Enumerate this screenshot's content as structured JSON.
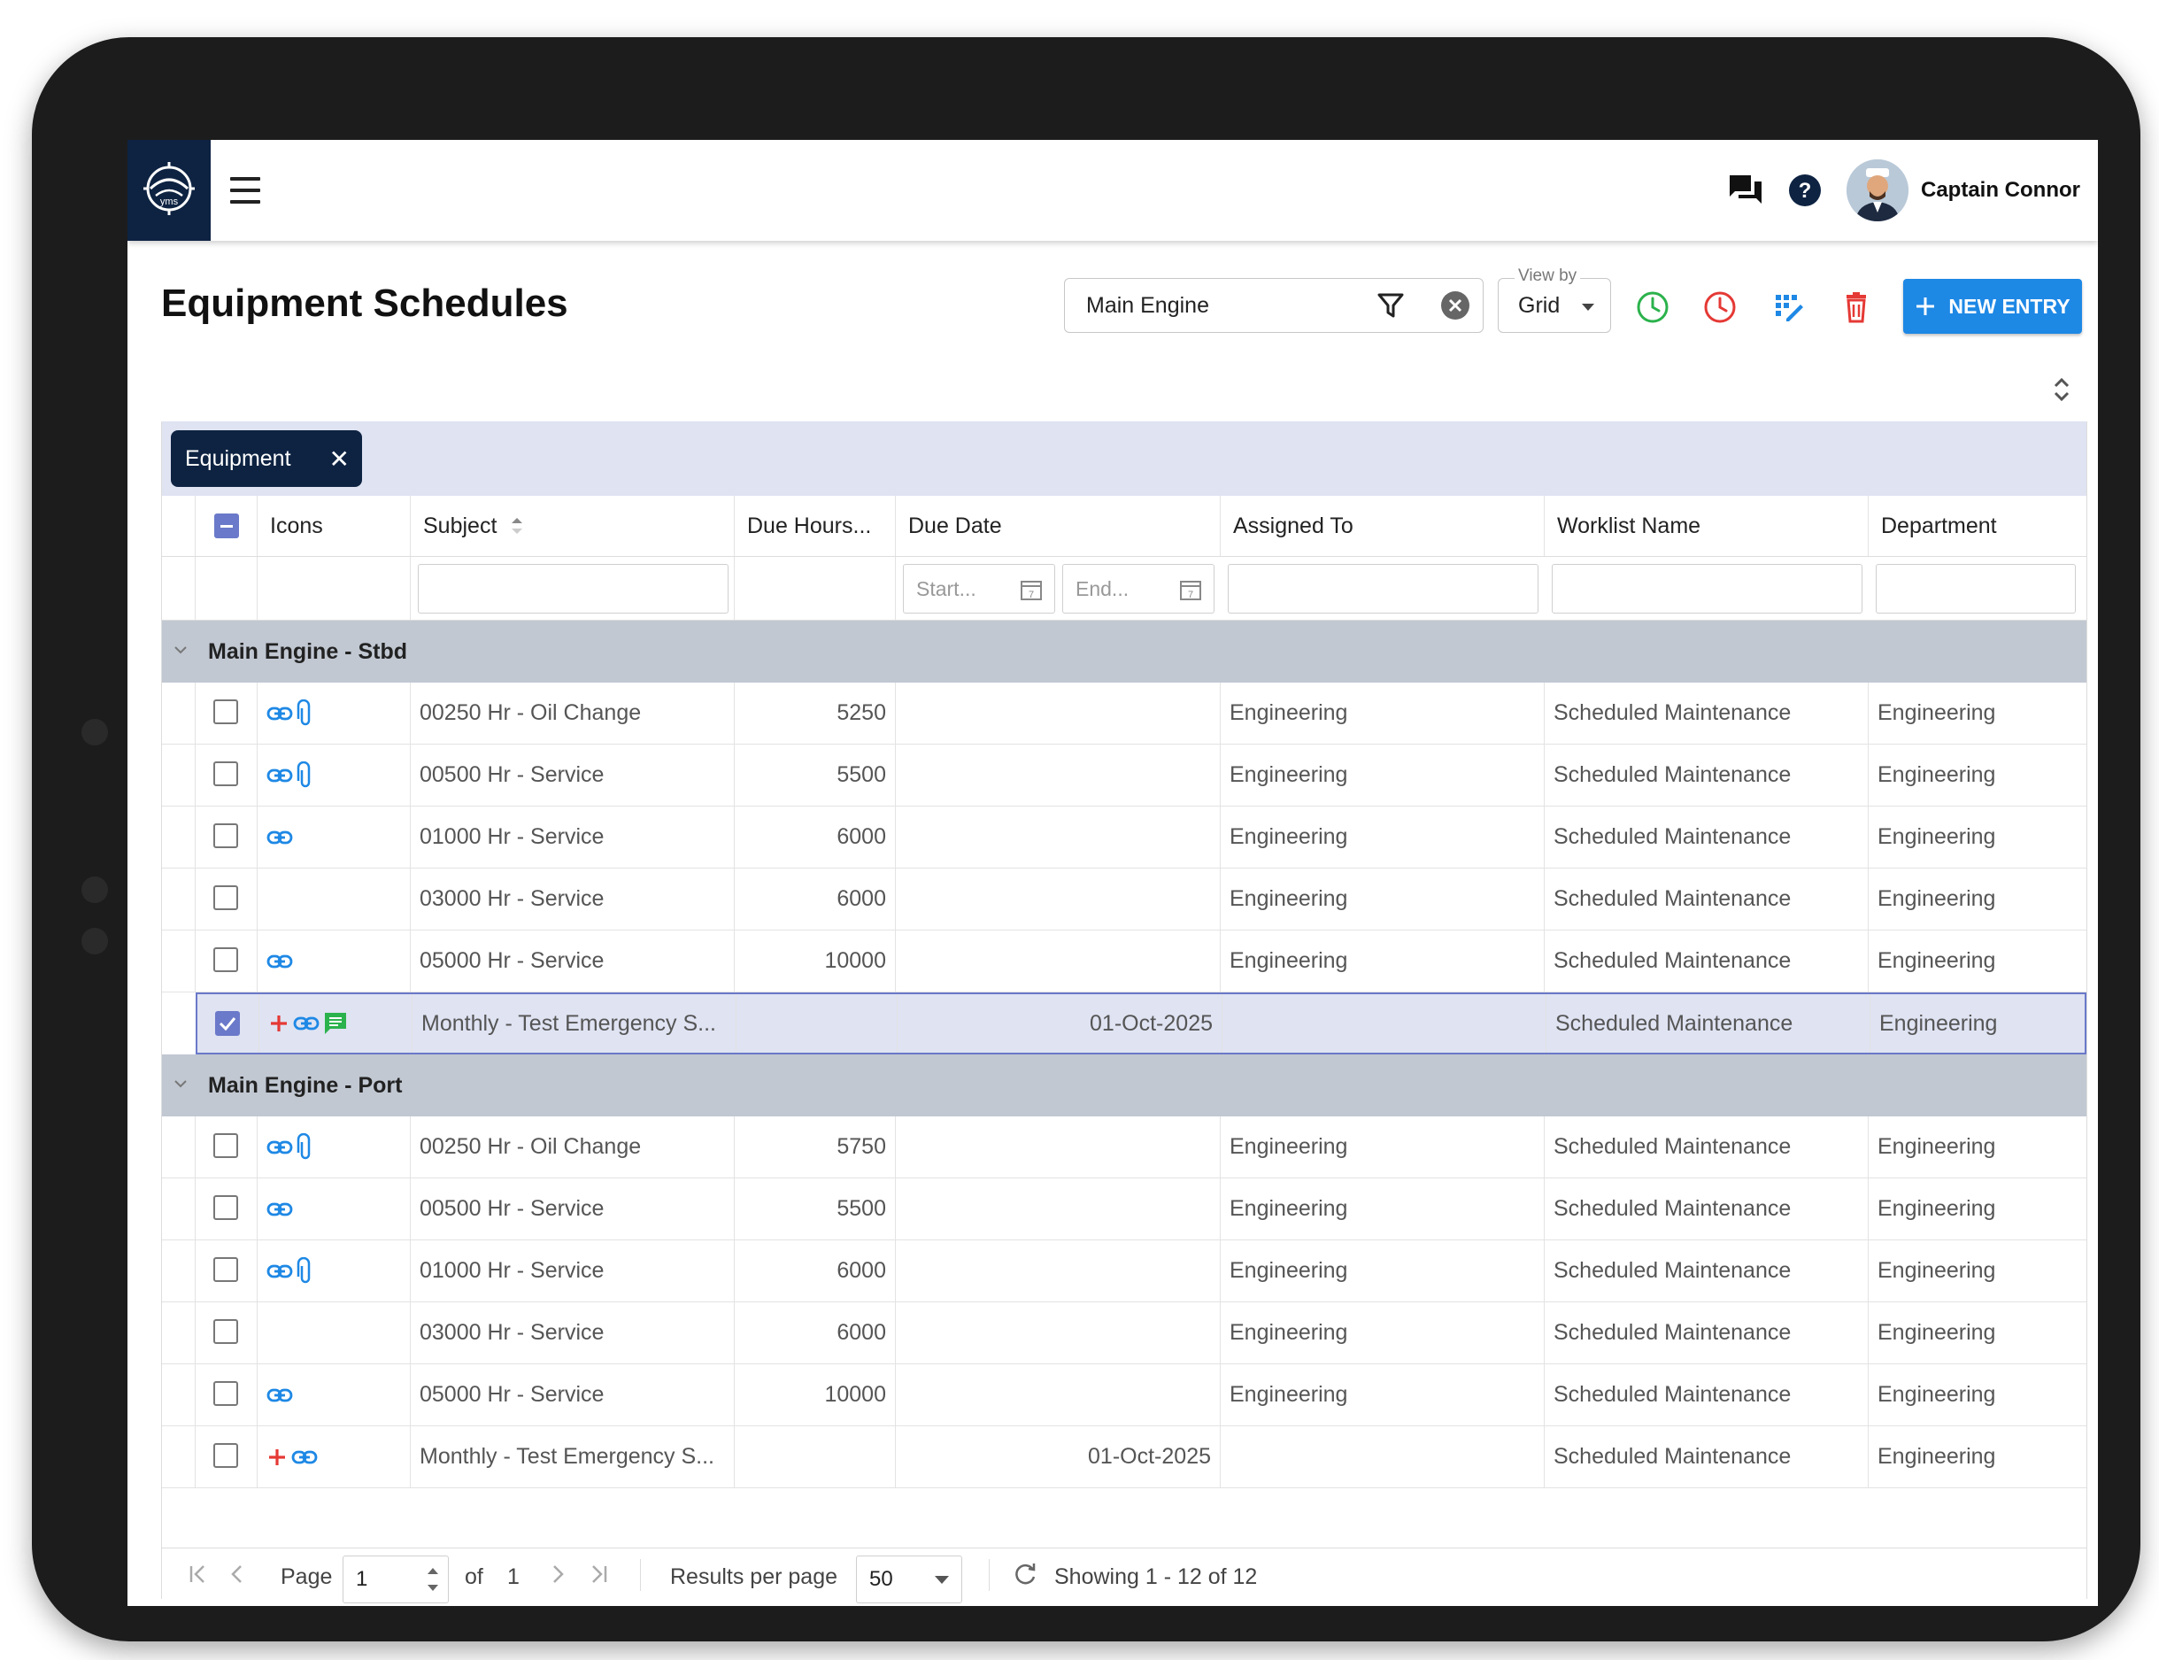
{
  "app": {
    "user_name": "Captain Connor"
  },
  "page": {
    "title": "Equipment Schedules"
  },
  "toolbar": {
    "search_value": "Main Engine",
    "view_by_label": "View by",
    "view_by_value": "Grid",
    "new_entry_label": "NEW ENTRY",
    "colors": {
      "accent": "#1e88e5",
      "green": "#2bb24c",
      "red": "#e53935",
      "navy": "#0e2342"
    }
  },
  "grid": {
    "group_chip": "Equipment",
    "columns": {
      "icons": "Icons",
      "subject": "Subject",
      "due_hours": "Due Hours...",
      "due_date": "Due Date",
      "assigned_to": "Assigned To",
      "worklist_name": "Worklist Name",
      "department": "Department"
    },
    "filters": {
      "start_placeholder": "Start...",
      "end_placeholder": "End..."
    },
    "groups": [
      {
        "title": "Main Engine - Stbd",
        "rows": [
          {
            "subject": "00250 Hr - Oil Change",
            "due_hours": "5250",
            "due_date": "",
            "assigned_to": "Engineering",
            "worklist": "Scheduled Maintenance",
            "department": "Engineering",
            "icons": [
              "link-icon",
              "paperclip-icon"
            ],
            "checked": false
          },
          {
            "subject": "00500 Hr - Service",
            "due_hours": "5500",
            "due_date": "",
            "assigned_to": "Engineering",
            "worklist": "Scheduled Maintenance",
            "department": "Engineering",
            "icons": [
              "link-icon",
              "paperclip-icon"
            ],
            "checked": false
          },
          {
            "subject": "01000 Hr - Service",
            "due_hours": "6000",
            "due_date": "",
            "assigned_to": "Engineering",
            "worklist": "Scheduled Maintenance",
            "department": "Engineering",
            "icons": [
              "link-icon"
            ],
            "checked": false
          },
          {
            "subject": "03000 Hr - Service",
            "due_hours": "6000",
            "due_date": "",
            "assigned_to": "Engineering",
            "worklist": "Scheduled Maintenance",
            "department": "Engineering",
            "icons": [],
            "checked": false
          },
          {
            "subject": "05000 Hr - Service",
            "due_hours": "10000",
            "due_date": "",
            "assigned_to": "Engineering",
            "worklist": "Scheduled Maintenance",
            "department": "Engineering",
            "icons": [
              "link-icon"
            ],
            "checked": false
          },
          {
            "subject": "Monthly - Test Emergency S...",
            "due_hours": "",
            "due_date": "01-Oct-2025",
            "assigned_to": "",
            "worklist": "Scheduled Maintenance",
            "department": "Engineering",
            "icons": [
              "plus-icon",
              "link-icon",
              "comment-icon"
            ],
            "checked": true
          }
        ]
      },
      {
        "title": "Main Engine - Port",
        "rows": [
          {
            "subject": "00250 Hr - Oil Change",
            "due_hours": "5750",
            "due_date": "",
            "assigned_to": "Engineering",
            "worklist": "Scheduled Maintenance",
            "department": "Engineering",
            "icons": [
              "link-icon",
              "paperclip-icon"
            ],
            "checked": false
          },
          {
            "subject": "00500 Hr - Service",
            "due_hours": "5500",
            "due_date": "",
            "assigned_to": "Engineering",
            "worklist": "Scheduled Maintenance",
            "department": "Engineering",
            "icons": [
              "link-icon"
            ],
            "checked": false
          },
          {
            "subject": "01000 Hr - Service",
            "due_hours": "6000",
            "due_date": "",
            "assigned_to": "Engineering",
            "worklist": "Scheduled Maintenance",
            "department": "Engineering",
            "icons": [
              "link-icon",
              "paperclip-icon"
            ],
            "checked": false
          },
          {
            "subject": "03000 Hr - Service",
            "due_hours": "6000",
            "due_date": "",
            "assigned_to": "Engineering",
            "worklist": "Scheduled Maintenance",
            "department": "Engineering",
            "icons": [],
            "checked": false
          },
          {
            "subject": "05000 Hr - Service",
            "due_hours": "10000",
            "due_date": "",
            "assigned_to": "Engineering",
            "worklist": "Scheduled Maintenance",
            "department": "Engineering",
            "icons": [
              "link-icon"
            ],
            "checked": false
          },
          {
            "subject": "Monthly - Test Emergency S...",
            "due_hours": "",
            "due_date": "01-Oct-2025",
            "assigned_to": "",
            "worklist": "Scheduled Maintenance",
            "department": "Engineering",
            "icons": [
              "plus-icon",
              "link-icon"
            ],
            "checked": false
          }
        ]
      }
    ]
  },
  "pager": {
    "page_label": "Page",
    "page_value": "1",
    "of_label": "of",
    "total_pages": "1",
    "results_label": "Results per page",
    "results_value": "50",
    "showing": "Showing 1 - 12 of 12"
  }
}
